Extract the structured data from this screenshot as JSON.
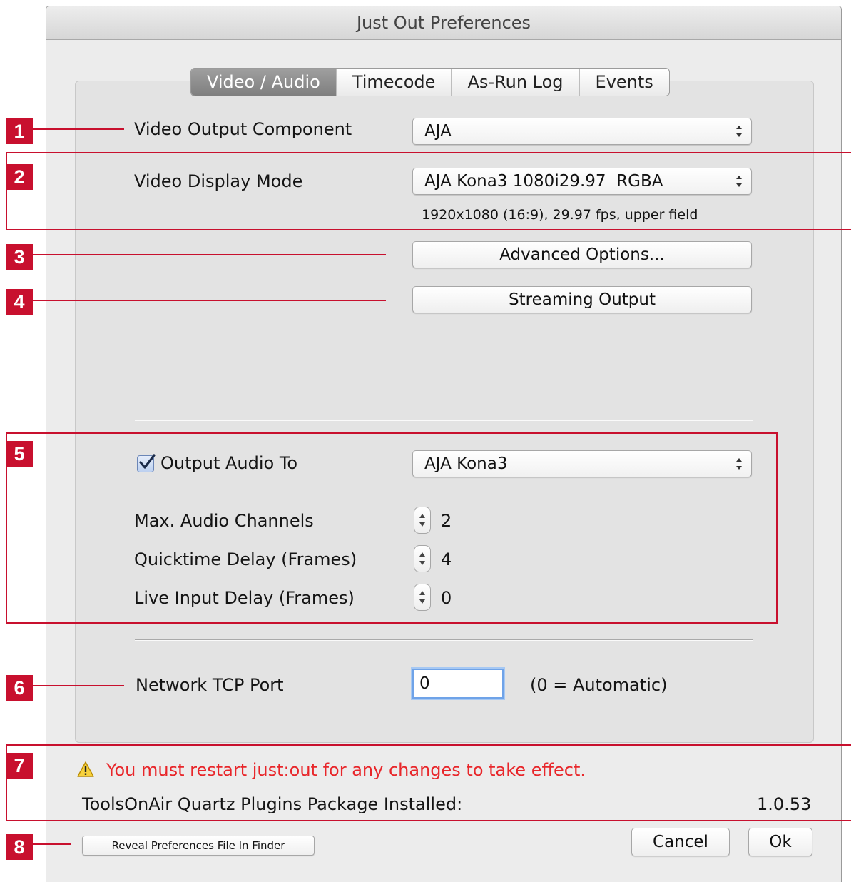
{
  "window": {
    "title": "Just Out Preferences"
  },
  "tabs": [
    {
      "label": "Video / Audio",
      "active": true
    },
    {
      "label": "Timecode",
      "active": false
    },
    {
      "label": "As-Run Log",
      "active": false
    },
    {
      "label": "Events",
      "active": false
    }
  ],
  "video": {
    "output_component_label": "Video Output Component",
    "output_component_value": "AJA",
    "display_mode_label": "Video Display Mode",
    "display_mode_value": "AJA Kona3 1080i29.97  RGBA",
    "display_mode_info": "1920x1080 (16:9), 29.97 fps, upper field",
    "advanced_options_button": "Advanced Options...",
    "streaming_output_button": "Streaming Output"
  },
  "audio": {
    "output_audio_label": "Output Audio To",
    "output_audio_checked": true,
    "output_audio_value": "AJA Kona3",
    "max_channels_label": "Max. Audio Channels",
    "max_channels_value": "2",
    "quicktime_delay_label": "Quicktime Delay (Frames)",
    "quicktime_delay_value": "4",
    "live_input_delay_label": "Live Input Delay (Frames)",
    "live_input_delay_value": "0"
  },
  "network": {
    "tcp_port_label": "Network TCP Port",
    "tcp_port_value": "0",
    "tcp_port_hint": "(0 = Automatic)"
  },
  "footer": {
    "warning_icon": "warning-triangle-icon",
    "warning_text": "You must restart just:out for any changes to take effect.",
    "plugins_label": "ToolsOnAir Quartz Plugins Package Installed:",
    "plugins_version": "1.0.53",
    "reveal_button": "Reveal Preferences File In Finder",
    "cancel_button": "Cancel",
    "ok_button": "Ok"
  },
  "callouts": [
    "1",
    "2",
    "3",
    "4",
    "5",
    "6",
    "7",
    "8"
  ],
  "colors": {
    "callout_red": "#c8102e",
    "warning_red": "#e8262a",
    "active_tab": "#8c8c8c",
    "focus_ring": "#6fa3e8"
  }
}
